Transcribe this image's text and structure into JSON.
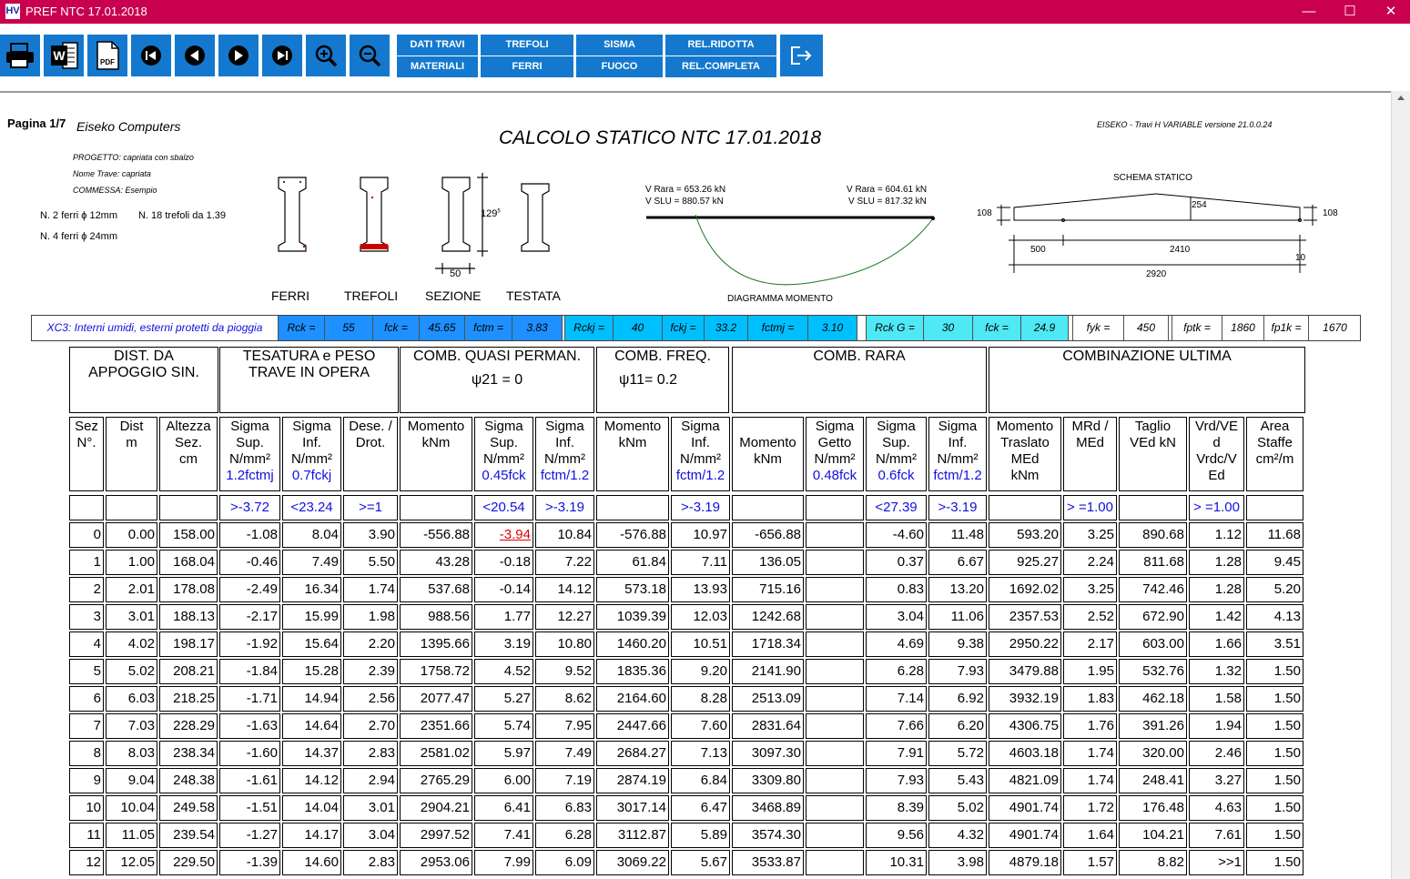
{
  "window": {
    "title": "PREF NTC 17.01.2018",
    "app_icon": "HV",
    "controls": [
      "minimize",
      "maximize",
      "close"
    ]
  },
  "toolbar": {
    "icon_buttons": [
      "printer-icon",
      "word-icon",
      "pdf-icon",
      "first-page-icon",
      "previous-page-icon",
      "next-page-icon",
      "last-page-icon",
      "zoom-in-icon",
      "zoom-out-icon"
    ],
    "word_label": "W",
    "pdf_label": "PDF",
    "text_buttons": {
      "dati_travi": "DATI TRAVI",
      "materiali": "MATERIALI",
      "trefoli": "TREFOLI",
      "ferri": "FERRI",
      "sisma": "SISMA",
      "fuoco": "FUOCO",
      "rel_ridotta": "REL.RIDOTTA",
      "rel_completa": "REL.COMPLETA"
    },
    "exit_icon": "exit-icon",
    "accent_color": "#1479ce"
  },
  "report": {
    "page": "Pagina 1/7",
    "company": "Eiseko Computers",
    "title": "CALCOLO STATICO NTC 17.01.2018",
    "version": "EISEKO -  Travi H VARIABLE  versione  21.0.0.24",
    "progetto": "PROGETTO:  capriata con sbalzo",
    "nome_trave": "Nome Trave:  capriata",
    "commessa": "COMMESSA: Esempio",
    "ferri1": "N. 2 ferri ϕ 12mm",
    "trefoli_n": "N. 18 trefoli da 1.39",
    "ferri2": "N. 4 ferri ϕ 24mm",
    "section_labels": {
      "ferri": "FERRI",
      "trefoli": "TREFOLI",
      "sezione": "SEZIONE",
      "testata": "TESTATA"
    },
    "section_height": "129",
    "section_height_sup": "5",
    "section_width": "50",
    "moment": {
      "v_rara_left": "V Rara = 653.26 kN",
      "v_slu_left": "V SLU = 880.57 kN",
      "v_rara_right": "V Rara = 604.61 kN",
      "v_slu_right": "V SLU = 817.32 kN",
      "caption": "DIAGRAMMA MOMENTO"
    },
    "schema": {
      "title": "SCHEMA STATICO",
      "left_h": "108",
      "right_h": "108",
      "mid_h": "254",
      "d1": "500",
      "d2": "2410",
      "d3": "10",
      "total": "2920"
    }
  },
  "params": {
    "exposure": "XC3: Interni umidi, esterni protetti da pioggia",
    "items": [
      {
        "label": "Rck =",
        "value": "55"
      },
      {
        "label": "fck =",
        "value": "45.65"
      },
      {
        "label": "fctm =",
        "value": "3.83"
      },
      {
        "label": "Rckj =",
        "value": "40"
      },
      {
        "label": "fckj =",
        "value": "33.2"
      },
      {
        "label": "fctmj =",
        "value": "3.10"
      },
      {
        "label": "Rck G =",
        "value": "30"
      },
      {
        "label": "fck =",
        "value": "24.9"
      },
      {
        "label": "fyk =",
        "value": "450"
      },
      {
        "label": "fptk =",
        "value": "1860"
      },
      {
        "label": "fp1k =",
        "value": "1670"
      }
    ]
  },
  "table": {
    "groups": {
      "dist": "DIST. DA\nAPPOGGIO SIN.",
      "tesatura": "TESATURA e PESO\nTRAVE IN OPERA",
      "quasi": "COMB. QUASI PERMAN.",
      "quasi_psi": "ψ21  = 0",
      "freq": "COMB. FREQ.",
      "freq_psi": "ψ11= 0.2",
      "rara": "COMB. RARA",
      "ultima": "COMBINAZIONE ULTIMA"
    },
    "columns": [
      {
        "h": "Sez\nN°.",
        "sub": ""
      },
      {
        "h": "Dist\nm",
        "sub": ""
      },
      {
        "h": "Altezza\nSez.\ncm",
        "sub": ""
      },
      {
        "h": "Sigma\nSup.\nN/mm²",
        "sub": "1.2fctmj"
      },
      {
        "h": "Sigma\nInf.\nN/mm²",
        "sub": "0.7fckj"
      },
      {
        "h": "Dese. /\nDrot.",
        "sub": ""
      },
      {
        "h": "Momento\nkNm",
        "sub": ""
      },
      {
        "h": "Sigma\nSup.\nN/mm²",
        "sub": "0.45fck"
      },
      {
        "h": "Sigma\nInf.\nN/mm²",
        "sub": "fctm/1.2"
      },
      {
        "h": "Momento\nkNm",
        "sub": ""
      },
      {
        "h": "Sigma\nInf.\nN/mm²",
        "sub": "fctm/1.2"
      },
      {
        "h": "\nMomento\nkNm",
        "sub": ""
      },
      {
        "h": "Sigma\nGetto\nN/mm²",
        "sub": "0.48fck"
      },
      {
        "h": "Sigma\nSup.\nN/mm²",
        "sub": "0.6fck"
      },
      {
        "h": "Sigma\nInf.\nN/mm²",
        "sub": "fctm/1.2"
      },
      {
        "h": "Momento\nTraslato\nMEd\nkNm",
        "sub": ""
      },
      {
        "h": "MRd /\nMEd",
        "sub": ""
      },
      {
        "h": "Taglio\nVEd kN",
        "sub": ""
      },
      {
        "h": "Vrd/VE\nd\nVrdc/V\nEd",
        "sub": ""
      },
      {
        "h": "Area\nStaffe\ncm²/m",
        "sub": ""
      }
    ],
    "limits": [
      "",
      "",
      "",
      ">-3.72",
      "<23.24",
      ">=1",
      "",
      "<20.54",
      ">-3.19",
      "",
      ">-3.19",
      "",
      "",
      "<27.39",
      ">-3.19",
      "",
      "> =1.00",
      "",
      "> =1.00",
      ""
    ],
    "rows": [
      [
        "0",
        "0.00",
        "158.00",
        "-1.08",
        "8.04",
        "3.90",
        "-556.88",
        "-3.94",
        "10.84",
        "-576.88",
        "10.97",
        "-656.88",
        "",
        "-4.60",
        "11.48",
        "593.20",
        "3.25",
        "890.68",
        "1.12",
        "11.68"
      ],
      [
        "1",
        "1.00",
        "168.04",
        "-0.46",
        "7.49",
        "5.50",
        "43.28",
        "-0.18",
        "7.22",
        "61.84",
        "7.11",
        "136.05",
        "",
        "0.37",
        "6.67",
        "925.27",
        "2.24",
        "811.68",
        "1.28",
        "9.45"
      ],
      [
        "2",
        "2.01",
        "178.08",
        "-2.49",
        "16.34",
        "1.74",
        "537.68",
        "-0.14",
        "14.12",
        "573.18",
        "13.93",
        "715.16",
        "",
        "0.83",
        "13.20",
        "1692.02",
        "3.25",
        "742.46",
        "1.28",
        "5.20"
      ],
      [
        "3",
        "3.01",
        "188.13",
        "-2.17",
        "15.99",
        "1.98",
        "988.56",
        "1.77",
        "12.27",
        "1039.39",
        "12.03",
        "1242.68",
        "",
        "3.04",
        "11.06",
        "2357.53",
        "2.52",
        "672.90",
        "1.42",
        "4.13"
      ],
      [
        "4",
        "4.02",
        "198.17",
        "-1.92",
        "15.64",
        "2.20",
        "1395.66",
        "3.19",
        "10.80",
        "1460.20",
        "10.51",
        "1718.34",
        "",
        "4.69",
        "9.38",
        "2950.22",
        "2.17",
        "603.00",
        "1.66",
        "3.51"
      ],
      [
        "5",
        "5.02",
        "208.21",
        "-1.84",
        "15.28",
        "2.39",
        "1758.72",
        "4.52",
        "9.52",
        "1835.36",
        "9.20",
        "2141.90",
        "",
        "6.28",
        "7.93",
        "3479.88",
        "1.95",
        "532.76",
        "1.32",
        "1.50"
      ],
      [
        "6",
        "6.03",
        "218.25",
        "-1.71",
        "14.94",
        "2.56",
        "2077.47",
        "5.27",
        "8.62",
        "2164.60",
        "8.28",
        "2513.09",
        "",
        "7.14",
        "6.92",
        "3932.19",
        "1.83",
        "462.18",
        "1.58",
        "1.50"
      ],
      [
        "7",
        "7.03",
        "228.29",
        "-1.63",
        "14.64",
        "2.70",
        "2351.66",
        "5.74",
        "7.95",
        "2447.66",
        "7.60",
        "2831.64",
        "",
        "7.66",
        "6.20",
        "4306.75",
        "1.76",
        "391.26",
        "1.94",
        "1.50"
      ],
      [
        "8",
        "8.03",
        "238.34",
        "-1.60",
        "14.37",
        "2.83",
        "2581.02",
        "5.97",
        "7.49",
        "2684.27",
        "7.13",
        "3097.30",
        "",
        "7.91",
        "5.72",
        "4603.18",
        "1.74",
        "320.00",
        "2.46",
        "1.50"
      ],
      [
        "9",
        "9.04",
        "248.38",
        "-1.61",
        "14.12",
        "2.94",
        "2765.29",
        "6.00",
        "7.19",
        "2874.19",
        "6.84",
        "3309.80",
        "",
        "7.93",
        "5.43",
        "4821.09",
        "1.74",
        "248.41",
        "3.27",
        "1.50"
      ],
      [
        "10",
        "10.04",
        "249.58",
        "-1.51",
        "14.04",
        "3.01",
        "2904.21",
        "6.41",
        "6.83",
        "3017.14",
        "6.47",
        "3468.89",
        "",
        "8.39",
        "5.02",
        "4901.74",
        "1.72",
        "176.48",
        "4.63",
        "1.50"
      ],
      [
        "11",
        "11.05",
        "239.54",
        "-1.27",
        "14.17",
        "3.04",
        "2997.52",
        "7.41",
        "6.28",
        "3112.87",
        "5.89",
        "3574.30",
        "",
        "9.56",
        "4.32",
        "4901.74",
        "1.64",
        "104.21",
        "7.61",
        "1.50"
      ],
      [
        "12",
        "12.05",
        "229.50",
        "-1.39",
        "14.60",
        "2.83",
        "2953.06",
        "7.99",
        "6.09",
        "3069.22",
        "5.67",
        "3533.87",
        "",
        "10.31",
        "3.98",
        "4879.18",
        "1.57",
        "8.82",
        ">>1",
        "1.50"
      ]
    ],
    "highlight_cell": {
      "row": 0,
      "col": 7,
      "color": "#e00000"
    }
  }
}
